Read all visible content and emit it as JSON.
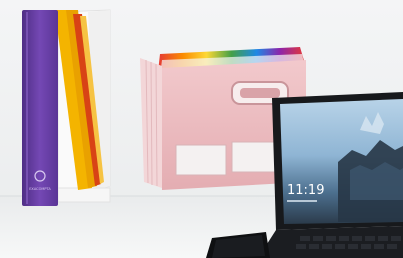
{
  "photo": {
    "binder_logo_text": "EXACOMPTA",
    "laptop_clock": "11:19"
  },
  "colors": {
    "wall": "#eef0f1",
    "desk": "#e7e9eb",
    "binder": "#6a3fa8",
    "file_box": "#e8b9bd",
    "laptop": "#17191c",
    "screen_sky": "#9fc1dc"
  }
}
